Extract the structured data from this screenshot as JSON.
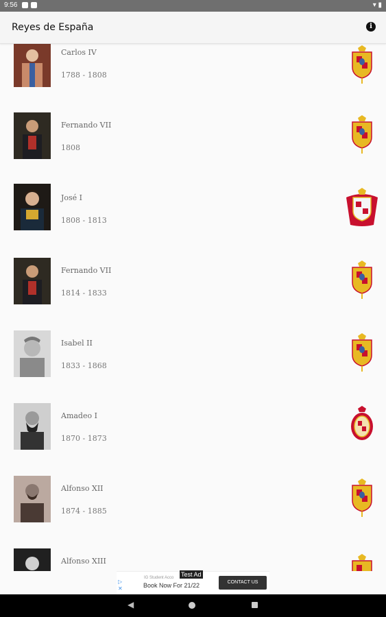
{
  "status_bar": {
    "time": "9:56"
  },
  "app_bar": {
    "title": "Reyes de España",
    "info_icon": "info-icon"
  },
  "kings": [
    {
      "name": "Carlos IV",
      "years": "1788 - 1808",
      "portrait": "portrait-carlos-iv",
      "coat_of_arms": "bourbon-arms-icon"
    },
    {
      "name": "Fernando VII",
      "years": "1808",
      "portrait": "portrait-fernando-vii",
      "coat_of_arms": "bourbon-arms-icon"
    },
    {
      "name": "José I",
      "years": "1808 - 1813",
      "portrait": "portrait-jose-i",
      "coat_of_arms": "bonaparte-arms-icon"
    },
    {
      "name": "Fernando VII",
      "years": "1814 - 1833",
      "portrait": "portrait-fernando-vii",
      "coat_of_arms": "bourbon-arms-icon"
    },
    {
      "name": "Isabel II",
      "years": "1833 - 1868",
      "portrait": "portrait-isabel-ii",
      "coat_of_arms": "bourbon-arms-icon"
    },
    {
      "name": "Amadeo I",
      "years": "1870 - 1873",
      "portrait": "portrait-amadeo-i",
      "coat_of_arms": "savoy-arms-icon"
    },
    {
      "name": "Alfonso XII",
      "years": "1874 - 1885",
      "portrait": "portrait-alfonso-xii",
      "coat_of_arms": "bourbon-arms-icon"
    },
    {
      "name": "Alfonso XIII",
      "years": "",
      "portrait": "portrait-alfonso-xiii",
      "coat_of_arms": "bourbon-arms-icon"
    }
  ],
  "ad": {
    "label": "Test Ad",
    "small_text": "IG Student Acco",
    "headline": "Book Now For 21/22",
    "cta": "CONTACT US"
  },
  "colors": {
    "app_bar": "#f5f5f5",
    "status_bar": "#6f6f6f",
    "list_bg": "#fafafa",
    "divider": "#e5e5e5",
    "gold": "#e8b923",
    "red": "#c8102e"
  }
}
